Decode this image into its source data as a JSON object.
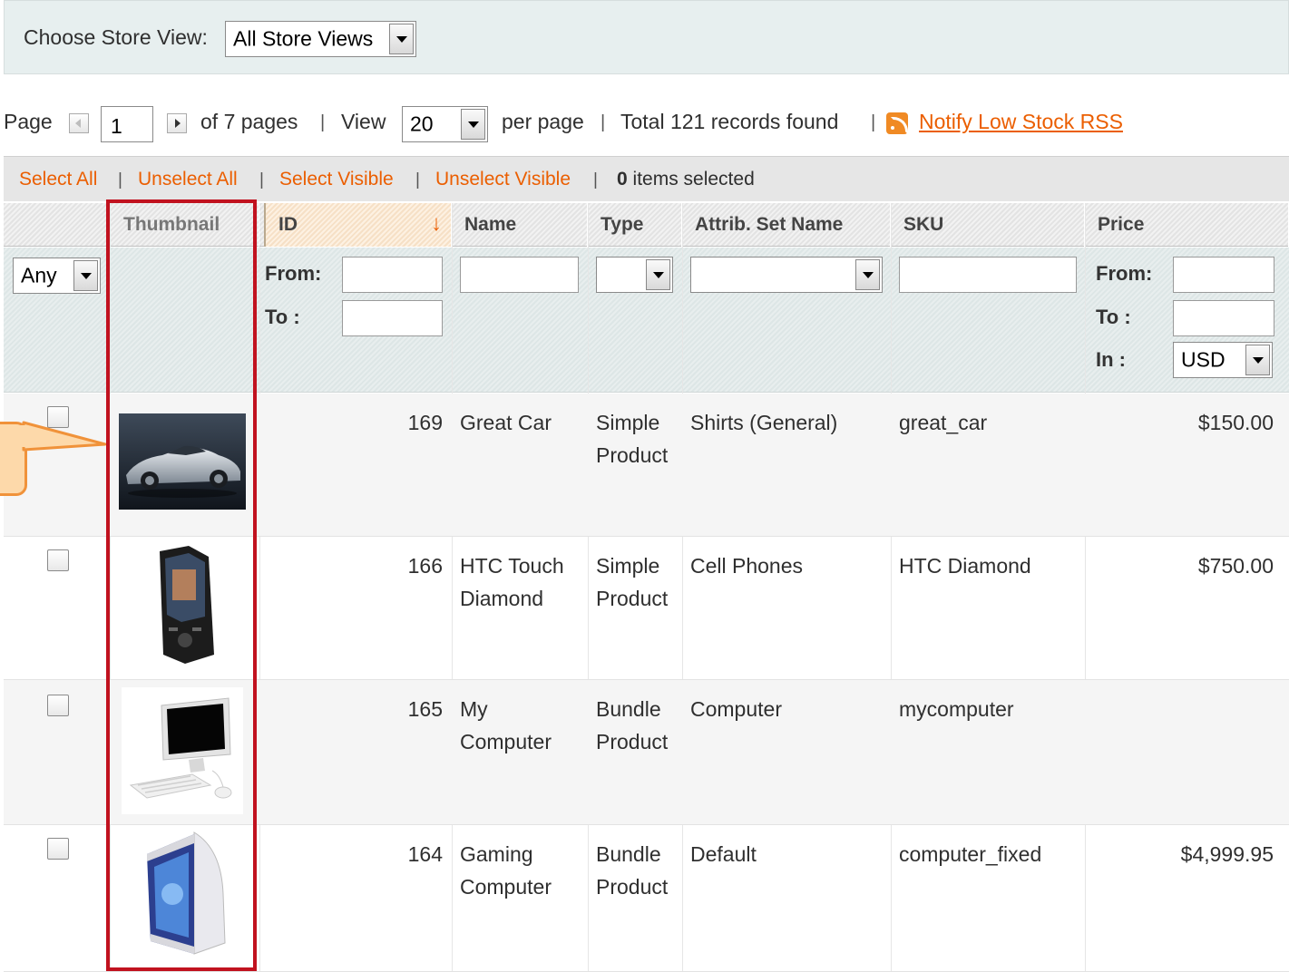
{
  "store_view": {
    "label": "Choose Store View:",
    "selected": "All Store Views"
  },
  "pager": {
    "page_label": "Page",
    "page_value": "1",
    "of_pages": "of 7 pages",
    "view_label": "View",
    "per_page_value": "20",
    "per_page_label": "per page",
    "total": "Total 121 records found",
    "rss_link": "Notify Low Stock RSS"
  },
  "massaction": {
    "select_all": "Select All",
    "unselect_all": "Unselect All",
    "select_visible": "Select Visible",
    "unselect_visible": "Unselect Visible",
    "count": "0",
    "count_suffix": " items selected",
    "sep": "|"
  },
  "columns": {
    "thumbnail": "Thumbnail",
    "id": "ID",
    "name": "Name",
    "type": "Type",
    "attrib_set": "Attrib. Set Name",
    "sku": "SKU",
    "price": "Price",
    "sort_arrow": "↓"
  },
  "filters": {
    "massaction_any": "Any",
    "from": "From:",
    "to": "To :",
    "in": "In :",
    "currency": "USD"
  },
  "rows": [
    {
      "id": "169",
      "name": [
        "Great Car"
      ],
      "type": [
        "Simple",
        "Product"
      ],
      "attrib_set": "Shirts (General)",
      "sku": "great_car",
      "price": "$150.00",
      "thumb": "car-thumbnail"
    },
    {
      "id": "166",
      "name": [
        "HTC Touch",
        "Diamond"
      ],
      "type": [
        "Simple",
        "Product"
      ],
      "attrib_set": "Cell Phones",
      "sku": "HTC Diamond",
      "price": "$750.00",
      "thumb": "phone-thumbnail"
    },
    {
      "id": "165",
      "name": [
        "My",
        "Computer"
      ],
      "type": [
        "Bundle",
        "Product"
      ],
      "attrib_set": "Computer",
      "sku": "mycomputer",
      "price": "",
      "thumb": "desktop-computer-thumbnail"
    },
    {
      "id": "164",
      "name": [
        "Gaming",
        "Computer"
      ],
      "type": [
        "Bundle",
        "Product"
      ],
      "attrib_set": "Default",
      "sku": "computer_fixed",
      "price": "$4,999.95",
      "thumb": "gaming-pc-thumbnail"
    }
  ],
  "colors": {
    "accent_link": "#eb5e00",
    "highlight": "#c1121f",
    "callout_fill": "#fdd9aa",
    "callout_border": "#f0923a"
  }
}
